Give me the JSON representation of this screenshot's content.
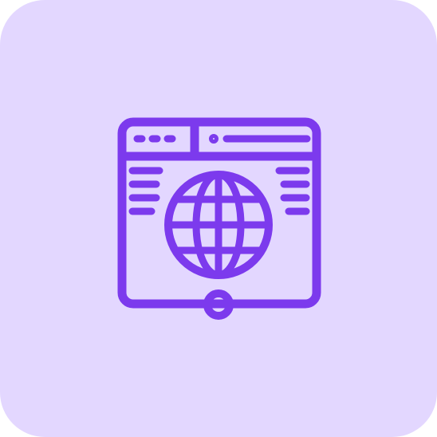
{
  "icon": {
    "name": "web-browser-globe-icon",
    "background_color": "#e3d7ff",
    "stroke_color": "#7c3aed"
  }
}
